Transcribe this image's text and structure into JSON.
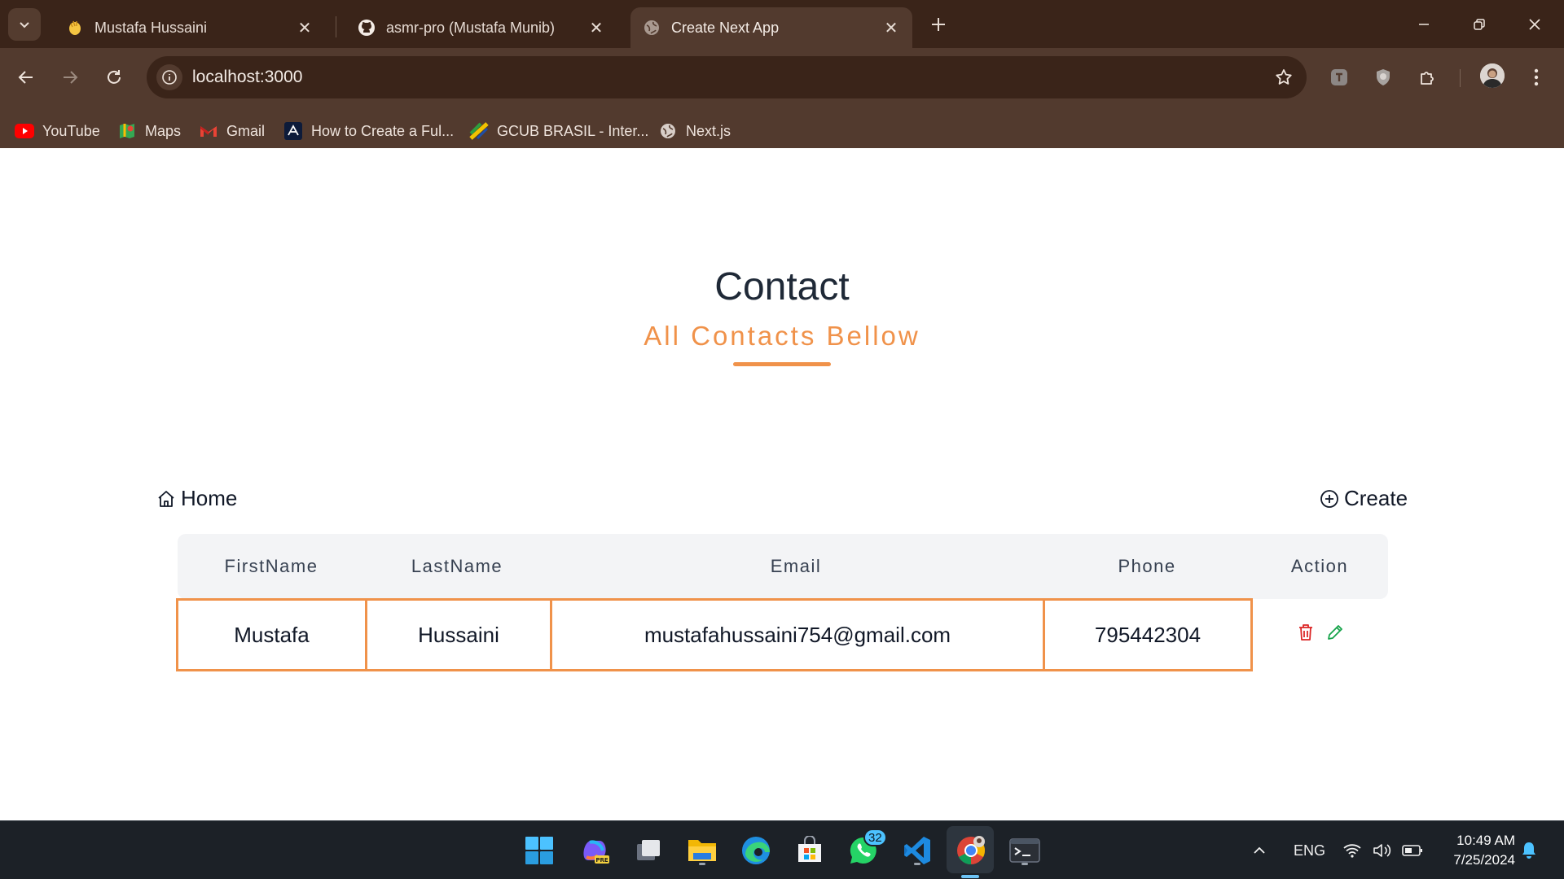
{
  "browser": {
    "tabs": [
      {
        "title": "Mustafa Hussaini",
        "icon": "waving-hand-icon",
        "active": false
      },
      {
        "title": "asmr-pro (Mustafa Munib)",
        "icon": "github-icon",
        "active": false
      },
      {
        "title": "Create Next App",
        "icon": "globe-icon",
        "active": true
      }
    ],
    "url": "localhost:3000",
    "bookmarks": [
      {
        "label": "YouTube",
        "icon": "youtube-icon"
      },
      {
        "label": "Maps",
        "icon": "maps-icon"
      },
      {
        "label": "Gmail",
        "icon": "gmail-icon"
      },
      {
        "label": "How to Create a Ful...",
        "icon": "react-icon"
      },
      {
        "label": "GCUB BRASIL - Inter...",
        "icon": "gcub-icon"
      },
      {
        "label": "Next.js",
        "icon": "globe-icon"
      }
    ]
  },
  "page": {
    "title": "Contact",
    "subtitle": "All Contacts Bellow",
    "home_link": "Home",
    "create_link": "Create",
    "table": {
      "headers": [
        "FirstName",
        "LastName",
        "Email",
        "Phone",
        "Action"
      ],
      "rows": [
        {
          "first_name": "Mustafa",
          "last_name": "Hussaini",
          "email": "mustafahussaini754@gmail.com",
          "phone": "795442304"
        }
      ]
    }
  },
  "taskbar": {
    "apps": [
      "windows-start-icon",
      "copilot-icon",
      "task-view-icon",
      "file-explorer-icon",
      "edge-icon",
      "microsoft-store-icon",
      "whatsapp-icon",
      "vscode-icon",
      "chrome-icon",
      "terminal-icon"
    ],
    "whatsapp_badge": "32",
    "language": "ENG",
    "time": "10:49 AM",
    "date": "7/25/2024"
  },
  "colors": {
    "accent": "#f0924a",
    "delete": "#dc2626",
    "edit": "#16a34a",
    "chrome_dark": "#3a2419",
    "chrome_toolbar": "#523a2e"
  }
}
